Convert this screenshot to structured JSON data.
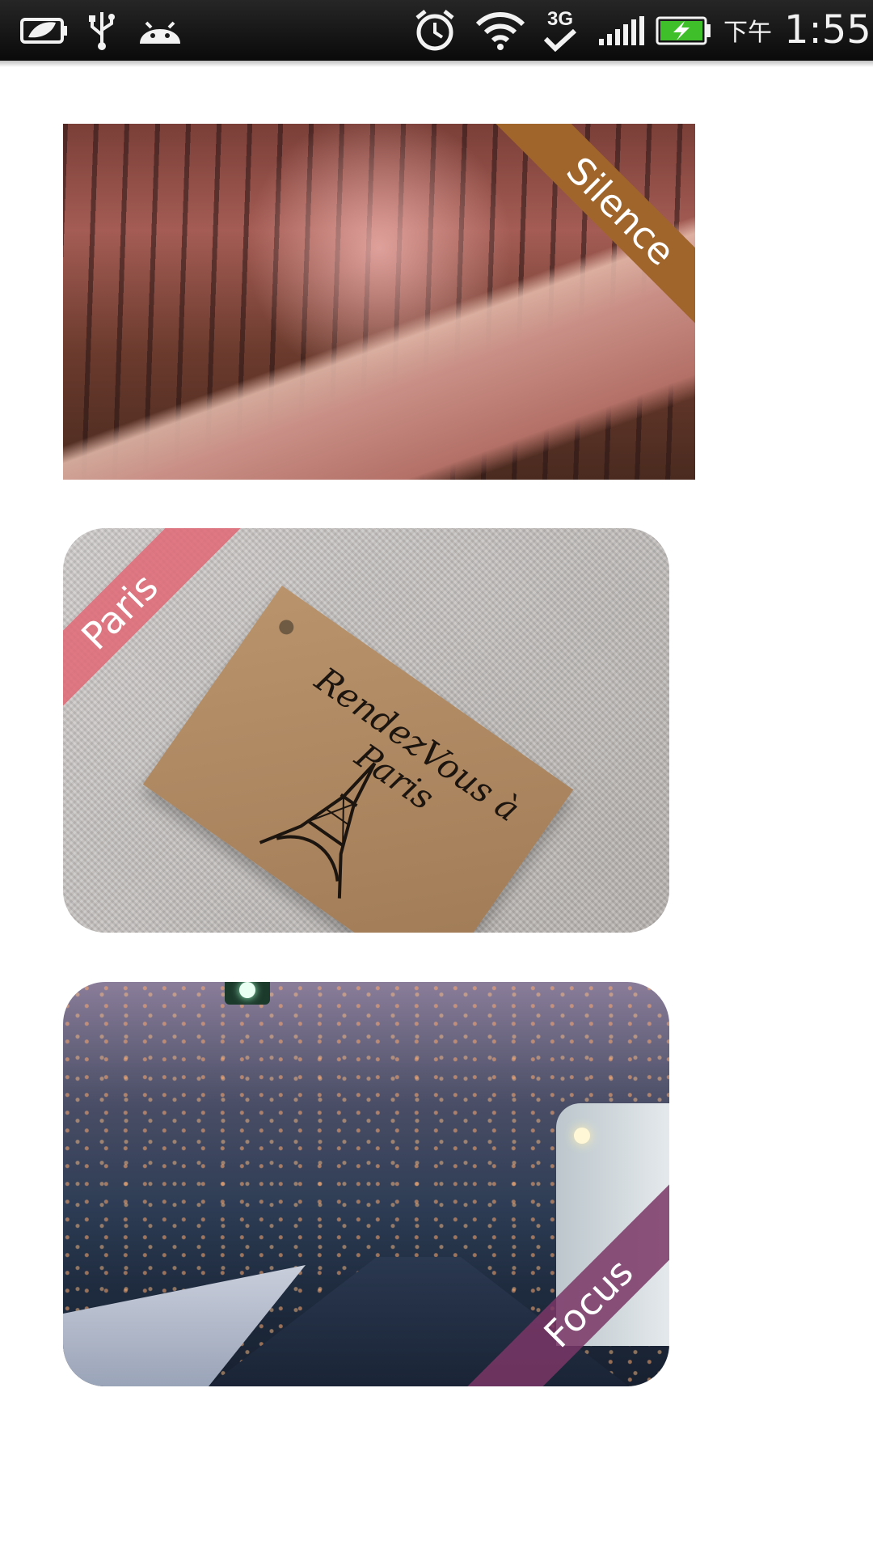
{
  "status_bar": {
    "ampm": "下午",
    "time": "1:55",
    "network": "3G",
    "icons": [
      "battery-saver-icon",
      "usb-icon",
      "android-icon",
      "alarm-icon",
      "wifi-icon",
      "network-3g-icon",
      "signal-icon",
      "battery-charging-icon"
    ],
    "battery_color": "#3fbf2a"
  },
  "cards": [
    {
      "label": "Silence",
      "scene": "misty forest road",
      "ribbon_color": "#a0652b"
    },
    {
      "label": "Paris",
      "scene": "Rendez-vous à Paris tag on linen",
      "tag_text": "RendezVous à Paris",
      "ribbon_color": "#e06976"
    },
    {
      "label": "Focus",
      "scene": "winter street with lights",
      "ribbon_color": "#7a3666"
    }
  ]
}
